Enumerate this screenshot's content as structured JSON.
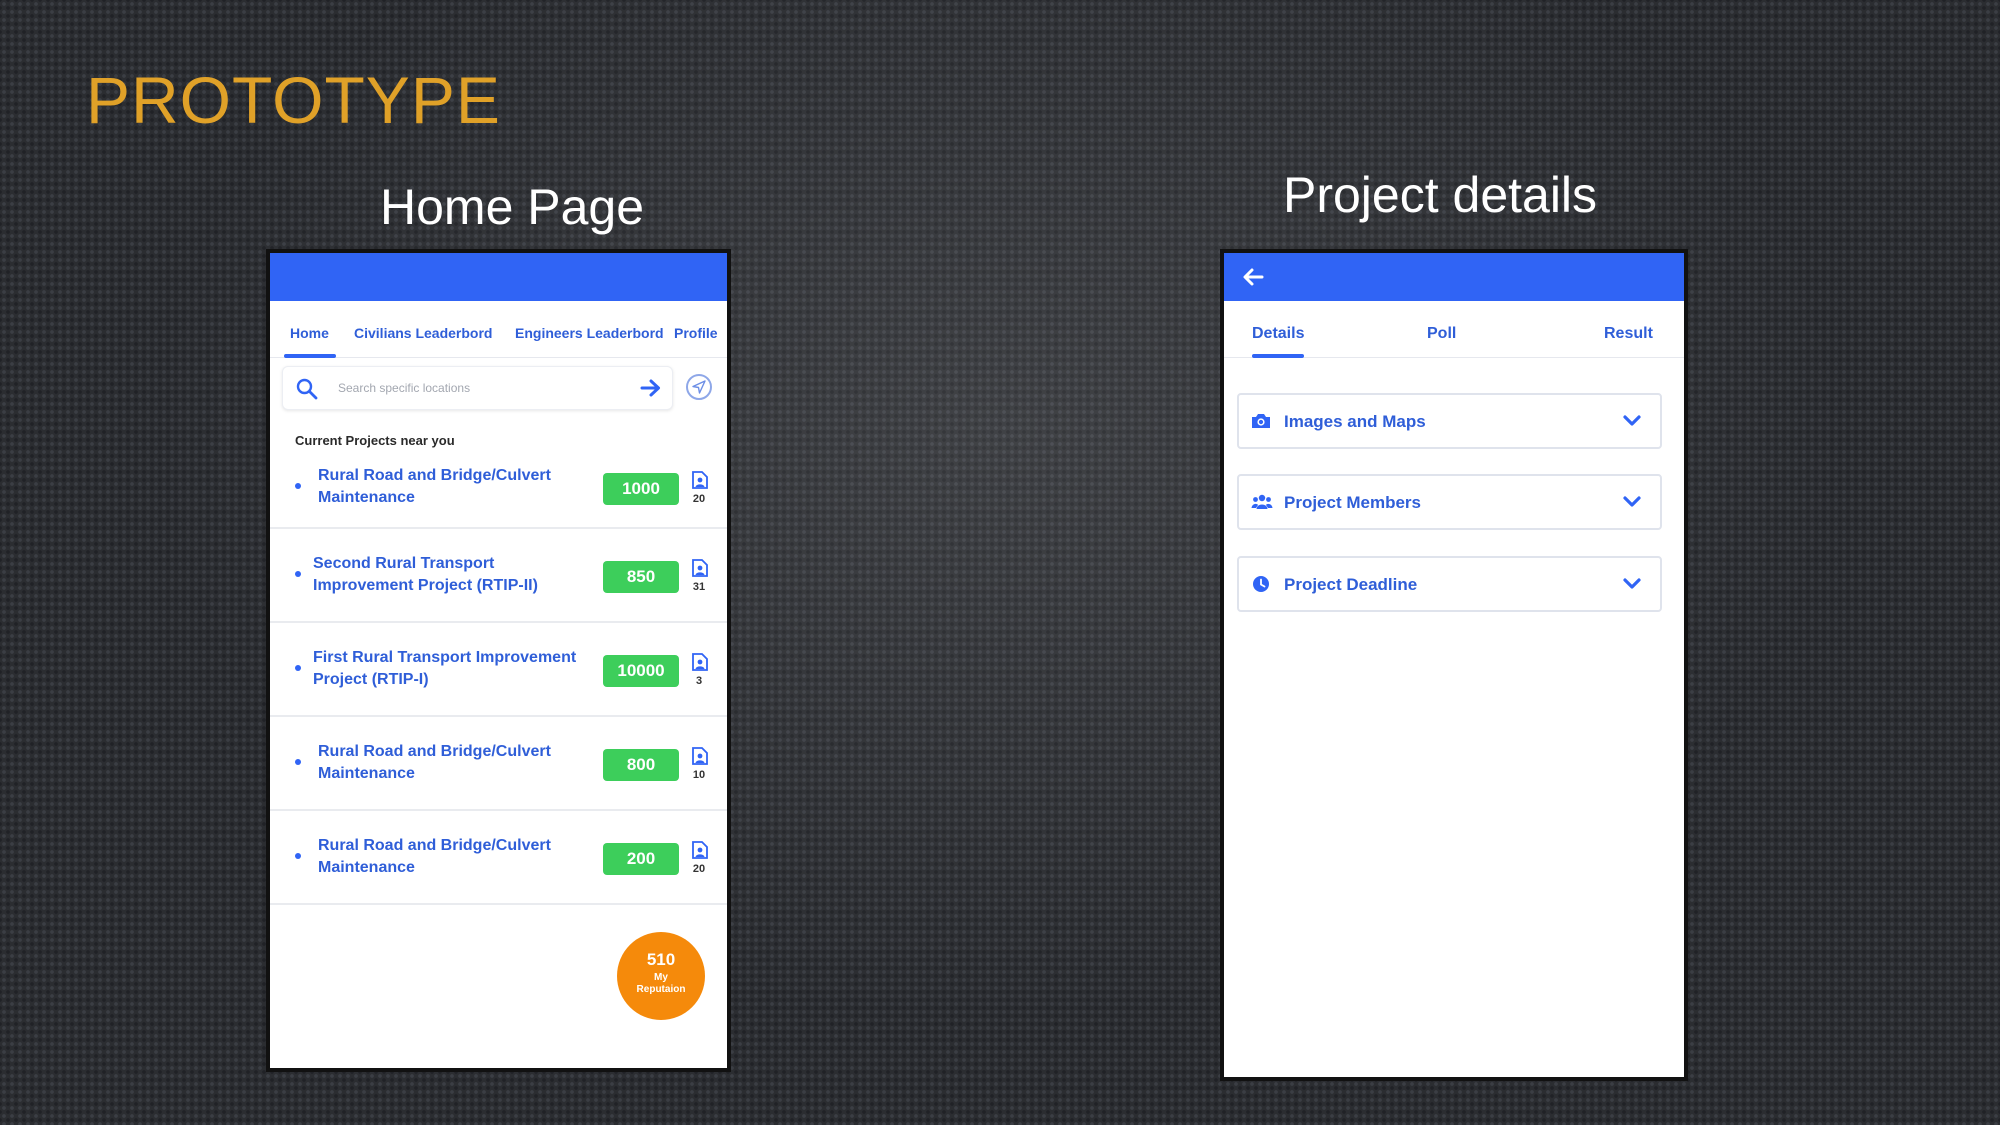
{
  "slide": {
    "title": "PROTOTYPE"
  },
  "home": {
    "heading": "Home Page",
    "tabs": [
      {
        "label": "Home",
        "active": true
      },
      {
        "label": "Civilians Leaderbord",
        "active": false
      },
      {
        "label": "Engineers Leaderbord",
        "active": false
      },
      {
        "label": "Profile",
        "active": false
      }
    ],
    "search": {
      "placeholder": "Search specific locations",
      "value": ""
    },
    "section_label": "Current Projects near you",
    "projects": [
      {
        "title": "Rural Road and Bridge/Culvert Maintenance",
        "score": "1000",
        "count": "20"
      },
      {
        "title": "Second Rural Transport Improvement Project (RTIP-II)",
        "score": "850",
        "count": "31"
      },
      {
        "title": "First Rural Transport Improvement Project (RTIP-I)",
        "score": "10000",
        "count": "3"
      },
      {
        "title": "Rural Road and Bridge/Culvert Maintenance",
        "score": "800",
        "count": "10"
      },
      {
        "title": "Rural Road and Bridge/Culvert Maintenance",
        "score": "200",
        "count": "20"
      }
    ],
    "reputation": {
      "value": "510",
      "label": "My Reputaion"
    }
  },
  "details": {
    "heading": "Project details",
    "tabs": [
      {
        "label": "Details",
        "active": true
      },
      {
        "label": "Poll",
        "active": false
      },
      {
        "label": "Result",
        "active": false
      }
    ],
    "sections": [
      {
        "label": "Images and Maps",
        "icon": "camera-icon"
      },
      {
        "label": "Project Members",
        "icon": "people-icon"
      },
      {
        "label": "Project Deadline",
        "icon": "clock-icon"
      }
    ]
  },
  "colors": {
    "accent": "#3064f5",
    "link_text": "#2f5ed8",
    "badge_green": "#3dce5b",
    "reputation_orange": "#f58a0b",
    "title_gold": "#e0a128"
  }
}
